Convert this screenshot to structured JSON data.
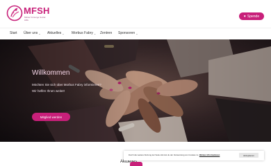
{
  "brand": {
    "name": "MFSH",
    "tagline": "Mütter Fürsorge Sozial Hilfe",
    "primary_color": "#c8207a"
  },
  "header": {
    "cta_icon": "heart-icon",
    "cta_label": "Spende"
  },
  "nav": {
    "items": [
      {
        "label": "Start",
        "has_dropdown": false
      },
      {
        "label": "Über uns",
        "has_dropdown": true
      },
      {
        "label": "Aktuelles",
        "has_dropdown": true
      },
      {
        "label": "Morbus Fabry",
        "has_dropdown": true
      },
      {
        "label": "Zentren",
        "has_dropdown": false
      },
      {
        "label": "Sponsoren",
        "has_dropdown": true
      }
    ]
  },
  "hero": {
    "title": "Willkommen",
    "line1": "Möchten Sie sich über Morbus Fabry informieren?",
    "line2": "Wir helfen Ihnen weiter!",
    "button_label": "Mitglied werden"
  },
  "section": {
    "heading": "Aktuelles"
  },
  "cookie": {
    "text": "Durch die weitere Nutzung der Seite stimmst du der Verwendung von Cookies zu.",
    "link_label": "Weitere Informationen",
    "accept_label": "Akzeptieren"
  }
}
